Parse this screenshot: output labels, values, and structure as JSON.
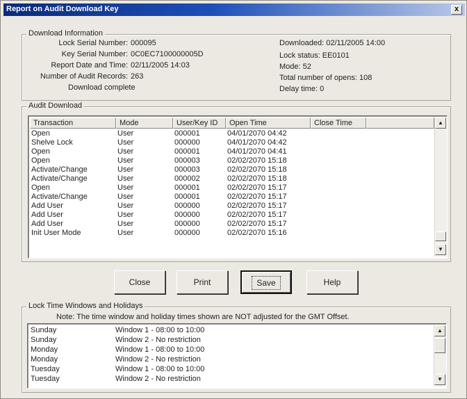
{
  "window": {
    "title": "Report on Audit Download Key",
    "close_glyph": "x"
  },
  "download_info": {
    "legend": "Download Information",
    "lock_serial_label": "Lock Serial Number:",
    "lock_serial_value": "000095",
    "key_serial_label": "Key Serial Number:",
    "key_serial_value": "0C0EC7100000005D",
    "report_date_label": "Report Date and Time:",
    "report_date_value": "02/11/2005 14:03",
    "num_records_label": "Number of Audit Records:",
    "num_records_value": "263",
    "download_complete": "Download complete",
    "downloaded": "Downloaded: 02/11/2005 14:00",
    "lock_status": "Lock status: EE0101",
    "mode": "Mode: 52",
    "total_opens": "Total number of opens: 108",
    "delay_time": "Delay time: 0"
  },
  "audit_download": {
    "legend": "Audit Download",
    "columns": [
      "Transaction",
      "Mode",
      "User/Key ID",
      "Open Time",
      "Close Time"
    ],
    "rows": [
      [
        "Open",
        "User",
        "000001",
        "04/01/2070 04:42",
        ""
      ],
      [
        "Shelve Lock",
        "User",
        "000000",
        "04/01/2070 04:42",
        ""
      ],
      [
        "Open",
        "User",
        "000001",
        "04/01/2070 04:41",
        ""
      ],
      [
        "Open",
        "User",
        "000003",
        "02/02/2070 15:18",
        ""
      ],
      [
        "Activate/Change",
        "User",
        "000003",
        "02/02/2070 15:18",
        ""
      ],
      [
        "Activate/Change",
        "User",
        "000002",
        "02/02/2070 15:18",
        ""
      ],
      [
        "Open",
        "User",
        "000001",
        "02/02/2070 15:17",
        ""
      ],
      [
        "Activate/Change",
        "User",
        "000001",
        "02/02/2070 15:17",
        ""
      ],
      [
        "Add User",
        "User",
        "000000",
        "02/02/2070 15:17",
        ""
      ],
      [
        "Add User",
        "User",
        "000000",
        "02/02/2070 15:17",
        ""
      ],
      [
        "Add User",
        "User",
        "000000",
        "02/02/2070 15:17",
        ""
      ],
      [
        "Init User Mode",
        "User",
        "000000",
        "02/02/2070 15:16",
        ""
      ]
    ]
  },
  "buttons": {
    "close": "Close",
    "print": "Print",
    "save": "Save",
    "help": "Help"
  },
  "lock_time": {
    "legend": "Lock Time Windows and Holidays",
    "note": "Note: The time window and holiday times shown are NOT adjusted for the GMT Offset.",
    "rows": [
      [
        "Sunday",
        "Window 1 - 08:00 to 10:00"
      ],
      [
        "Sunday",
        "Window 2 - No restriction"
      ],
      [
        "Monday",
        "Window 1 - 08:00 to 10:00"
      ],
      [
        "Monday",
        "Window 2 - No restriction"
      ],
      [
        "Tuesday",
        "Window 1 - 08:00 to 10:00"
      ],
      [
        "Tuesday",
        "Window 2 - No restriction"
      ]
    ]
  },
  "icons": {
    "scroll_up": "▲",
    "scroll_down": "▼"
  }
}
